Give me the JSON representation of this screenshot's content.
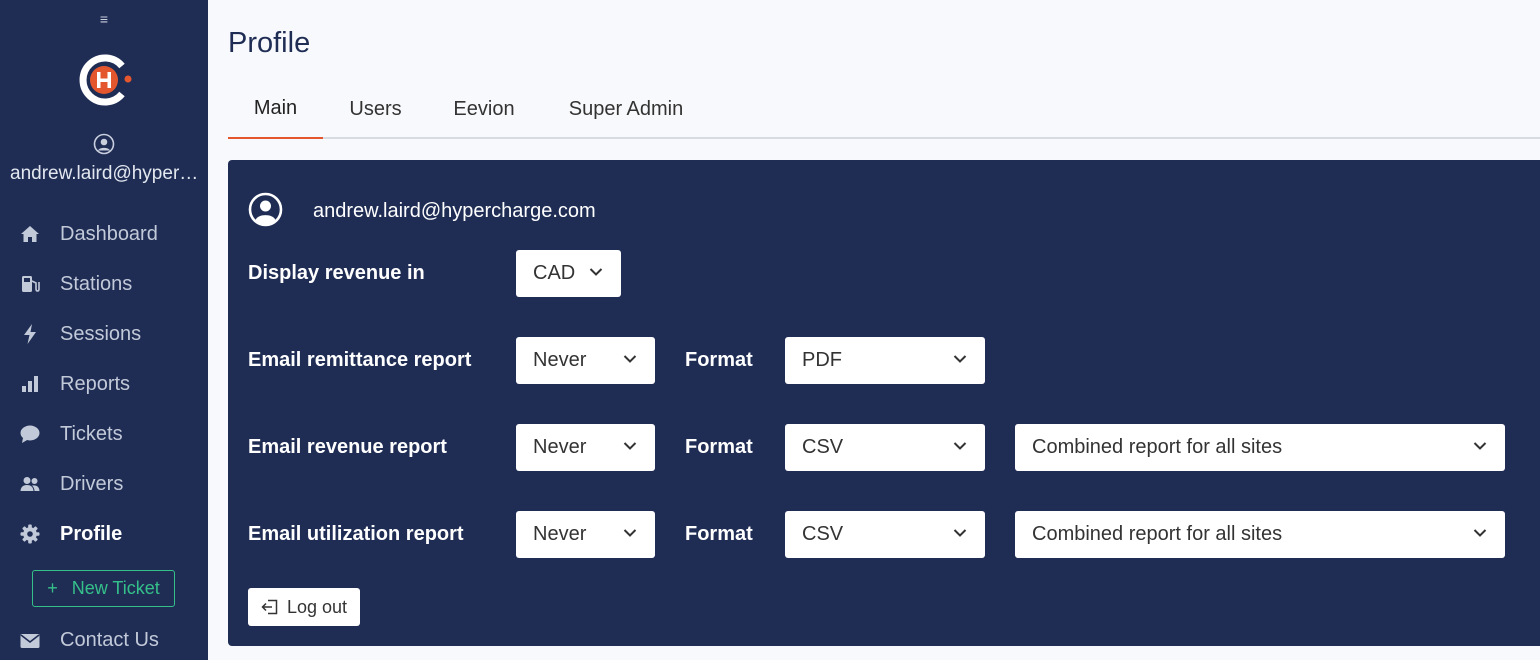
{
  "sidebar": {
    "menu_icon": "≡",
    "email": "andrew.laird@hypercharge.com",
    "items": [
      {
        "label": "Dashboard",
        "icon": "home-icon"
      },
      {
        "label": "Stations",
        "icon": "fuel-station-icon"
      },
      {
        "label": "Sessions",
        "icon": "lightning-icon"
      },
      {
        "label": "Reports",
        "icon": "bar-chart-icon"
      },
      {
        "label": "Tickets",
        "icon": "chat-bubble-icon"
      },
      {
        "label": "Drivers",
        "icon": "users-icon"
      },
      {
        "label": "Profile",
        "icon": "gear-icon",
        "active": true
      }
    ],
    "new_ticket": {
      "plus": "+",
      "label": "New Ticket"
    },
    "contact": {
      "label": "Contact Us",
      "icon": "mail-icon"
    }
  },
  "page": {
    "title": "Profile"
  },
  "tabs": [
    {
      "label": "Main",
      "active": true
    },
    {
      "label": "Users"
    },
    {
      "label": "Eevion"
    },
    {
      "label": "Super Admin"
    }
  ],
  "panel": {
    "email": "andrew.laird@hypercharge.com",
    "display_revenue": {
      "label": "Display revenue in",
      "value": "CAD"
    },
    "remittance": {
      "label": "Email remittance report",
      "frequency": "Never",
      "format_label": "Format",
      "format": "PDF"
    },
    "revenue": {
      "label": "Email revenue report",
      "frequency": "Never",
      "format_label": "Format",
      "format": "CSV",
      "scope": "Combined report for all sites"
    },
    "utilization": {
      "label": "Email utilization report",
      "frequency": "Never",
      "format_label": "Format",
      "format": "CSV",
      "scope": "Combined report for all sites"
    },
    "logout_label": "Log out"
  },
  "colors": {
    "sidebar_bg": "#1f2d55",
    "accent": "#e4572e",
    "new_ticket": "#35c08a"
  }
}
